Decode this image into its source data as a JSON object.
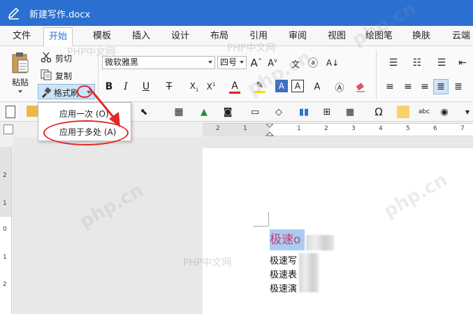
{
  "window": {
    "title": "新建写作.docx"
  },
  "tabs": [
    "文件",
    "开始",
    "模板",
    "插入",
    "设计",
    "布局",
    "引用",
    "审阅",
    "视图",
    "绘图笔",
    "换肤",
    "云端"
  ],
  "active_tab": "开始",
  "clipboard": {
    "paste_label": "粘贴",
    "cut_label": "剪切",
    "copy_label": "复制",
    "format_painter_label": "格式刷"
  },
  "font": {
    "family": "微软雅黑",
    "size": "四号"
  },
  "format_painter_menu": {
    "apply_once": "应用一次 (O)",
    "apply_multiple": "应用于多处 (A)"
  },
  "ruler": {
    "h_labels": [
      "2",
      "1",
      "1",
      "2",
      "3",
      "4",
      "5",
      "6",
      "7"
    ],
    "v_labels": [
      "2",
      "1",
      "0",
      "1",
      "2"
    ]
  },
  "document": {
    "heading": "极速o",
    "lines": [
      "极速写",
      "极速表",
      "极速演"
    ]
  },
  "watermarks": [
    "PHP中文网",
    "PHP中文网",
    "PHP中文网",
    "php.cn",
    "php.cn",
    "php.cn",
    "php.cn"
  ],
  "colors": {
    "title_bar": "#2b6fd0",
    "active_tab": "#2b6fd0",
    "highlight": "#a9cdf2",
    "heading_text": "#c83c78",
    "annotation": "#e02a2a"
  }
}
